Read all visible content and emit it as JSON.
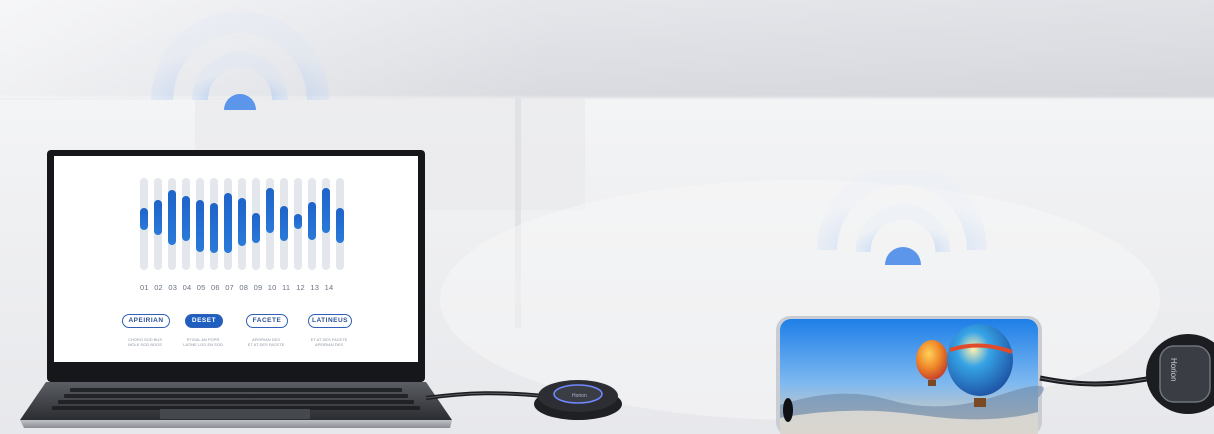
{
  "scene": {
    "description_colors": {
      "accent_blue": "#2a6fd6",
      "wifi_blue": "#6fa7f2"
    }
  },
  "laptop_screen": {
    "numbers": [
      "01",
      "02",
      "03",
      "04",
      "05",
      "06",
      "07",
      "08",
      "09",
      "10",
      "11",
      "12",
      "13",
      "14"
    ],
    "pills": [
      "APEIRIAN",
      "DESET",
      "FACETE",
      "LATINEUS"
    ],
    "captions": [
      "CHORO SOD BUS\nMOLE SOD BOOS",
      "RTISAL AN POPR\nLATINE LOG EN SOD",
      "APEIRIAN DES\nET AT DES FACETE",
      "ET AT DES FACETE\nAPEIRIAN DES"
    ]
  },
  "dongle": {
    "logo": "Horion"
  },
  "phone": {
    "content": "hot-air-balloons-wallpaper"
  }
}
